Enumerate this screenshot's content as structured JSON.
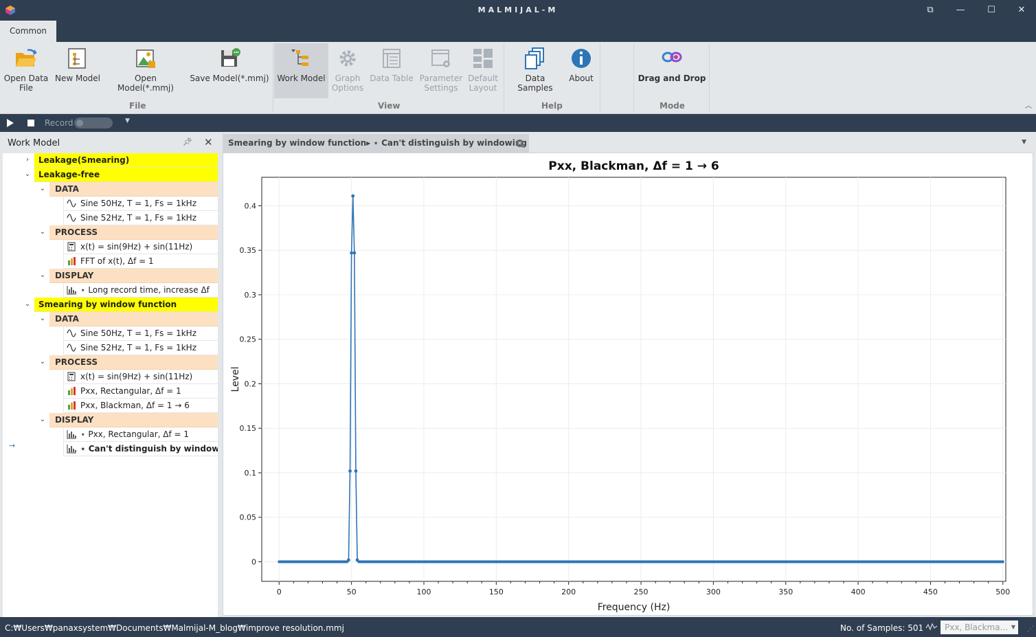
{
  "window": {
    "title": "MALMIJAL-M",
    "buttons": {
      "restore": "⧉",
      "minimize": "—",
      "maximize": "☐",
      "close": "✕"
    }
  },
  "ribbon": {
    "tab": "Common",
    "groups": {
      "file": "File",
      "view": "View",
      "help": "Help",
      "mode": "Mode"
    },
    "buttons": {
      "open_data_1": "Open Data",
      "open_data_2": "File",
      "new_model": "New Model",
      "open_model": "Open Model(*.mmj)",
      "save_model": "Save Model(*.mmj)",
      "work_model": "Work Model",
      "graph_options_1": "Graph",
      "graph_options_2": "Options",
      "data_table": "Data Table",
      "param_settings_1": "Parameter",
      "param_settings_2": "Settings",
      "default_layout_1": "Default",
      "default_layout_2": "Layout",
      "data_samples": "Data Samples",
      "about": "About",
      "drag_drop": "Drag and Drop"
    }
  },
  "toolbar": {
    "record_label": "Record"
  },
  "work_model": {
    "title": "Work Model",
    "nodes": {
      "n0": "Leakage(Smearing)",
      "n1": "Leakage-free",
      "n2": "DATA",
      "n3": "Sine 50Hz, T = 1, Fs = 1kHz",
      "n4": "Sine 52Hz, T = 1, Fs = 1kHz",
      "n5": "PROCESS",
      "n6": "x(t) = sin(9Hz) + sin(11Hz)",
      "n7": "FFT of x(t), Δf = 1",
      "n8": "DISPLAY",
      "n9": "⋆ Long record time, increase Δf",
      "n10": "Smearing by window function",
      "n11": "DATA",
      "n12": "Sine 50Hz, T = 1, Fs = 1kHz",
      "n13": "Sine 52Hz, T = 1, Fs = 1kHz",
      "n14": "PROCESS",
      "n15": "x(t) = sin(9Hz) + sin(11Hz)",
      "n16": "Pxx, Rectangular, Δf = 1",
      "n17": "Pxx, Blackman, Δf = 1 → 6",
      "n18": "DISPLAY",
      "n19": "⋆ Pxx, Rectangular, Δf = 1",
      "n20": "⋆ Can't distinguish by windowin"
    }
  },
  "document_tab": "Smearing by window function▸ ⋆ Can't distinguish by windowing",
  "colors": {
    "chrome": "#2f3e50",
    "ribbon_bg": "#e4e7ea",
    "node_group": "#ffff00",
    "node_section": "#fde0c2",
    "series": "#2e75b6"
  },
  "chart_data": {
    "type": "line",
    "title": "Pxx, Blackman, Δf = 1 → 6",
    "xlabel": "Frequency (Hz)",
    "ylabel": "Level",
    "xlim": [
      -12,
      502
    ],
    "ylim": [
      -0.022,
      0.432
    ],
    "xticks": [
      0,
      50,
      100,
      150,
      200,
      250,
      300,
      350,
      400,
      450,
      500
    ],
    "yticks": [
      0,
      0.05,
      0.1,
      0.15,
      0.2,
      0.25,
      0.3,
      0.35,
      0.4
    ],
    "ytick_labels": [
      "0",
      "0.05",
      "0.1",
      "0.15",
      "0.2",
      "0.25",
      "0.3",
      "0.35",
      "0.4"
    ],
    "grid": true,
    "legend": "none",
    "series": [
      {
        "x": [
          0,
          47,
          48,
          49,
          50,
          51,
          52,
          53,
          54,
          55,
          500
        ],
        "y": [
          0,
          0,
          0.002,
          0.102,
          0.347,
          0.411,
          0.347,
          0.102,
          0.002,
          0,
          0
        ]
      }
    ],
    "n_samples": 501
  },
  "status": {
    "path": "C:₩Users₩panaxsystem₩Documents₩Malmijal-M_blog₩improve resolution.mmj",
    "samples": "No. of Samples: 501",
    "combo_value": "Pxx, Blackma..."
  }
}
